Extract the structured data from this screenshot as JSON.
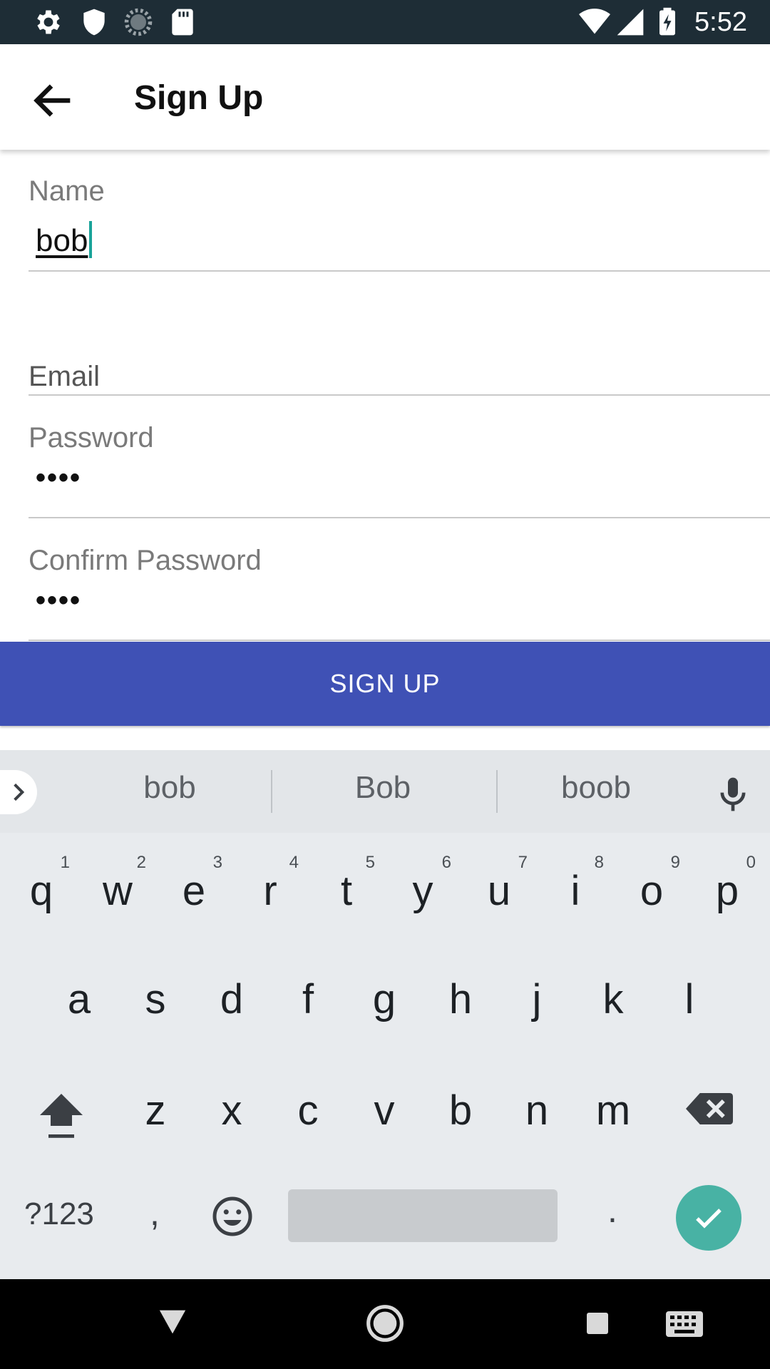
{
  "status_bar": {
    "time": "5:52",
    "icons_left": [
      "gear-icon",
      "shield-icon",
      "sync-icon",
      "sd-card-icon"
    ],
    "icons_right": [
      "wifi-icon",
      "signal-icon",
      "battery-charging-icon"
    ]
  },
  "app_bar": {
    "title": "Sign Up",
    "back_icon": "arrow-left-icon"
  },
  "form": {
    "name": {
      "label": "Name",
      "value": "bob"
    },
    "email": {
      "label": "Email",
      "value": ""
    },
    "password": {
      "label": "Password",
      "value": "••••"
    },
    "confirm_password": {
      "label": "Confirm Password",
      "value": "••••"
    },
    "submit_label": "SIGN UP",
    "accent_color": "#3f51b5"
  },
  "keyboard": {
    "suggestions": [
      "bob",
      "Bob",
      "boob"
    ],
    "row1": [
      {
        "key": "q",
        "hint": "1"
      },
      {
        "key": "w",
        "hint": "2"
      },
      {
        "key": "e",
        "hint": "3"
      },
      {
        "key": "r",
        "hint": "4"
      },
      {
        "key": "t",
        "hint": "5"
      },
      {
        "key": "y",
        "hint": "6"
      },
      {
        "key": "u",
        "hint": "7"
      },
      {
        "key": "i",
        "hint": "8"
      },
      {
        "key": "o",
        "hint": "9"
      },
      {
        "key": "p",
        "hint": "0"
      }
    ],
    "row2": [
      "a",
      "s",
      "d",
      "f",
      "g",
      "h",
      "j",
      "k",
      "l"
    ],
    "row3": [
      "z",
      "x",
      "c",
      "v",
      "b",
      "n",
      "m"
    ],
    "symbols_label": "?123",
    "comma": ",",
    "period": ".",
    "enter_color": "#48b2a4"
  },
  "nav_bar": {
    "icons": [
      "back-triangle-icon",
      "home-circle-icon",
      "recents-square-icon",
      "keyboard-icon"
    ]
  }
}
